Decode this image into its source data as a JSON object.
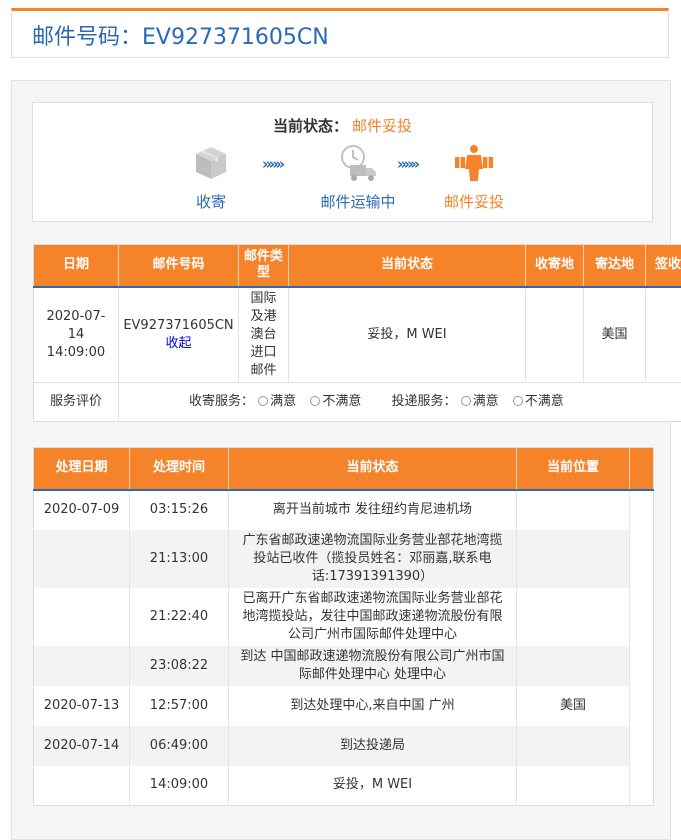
{
  "header": {
    "title": "邮件号码：EV927371605CN"
  },
  "status": {
    "label": "当前状态：",
    "value": "邮件妥投",
    "steps": [
      {
        "label": "收寄",
        "icon": "package-icon"
      },
      {
        "label": "邮件运输中",
        "icon": "truck-icon"
      },
      {
        "label": "邮件妥投",
        "icon": "delivery-person-icon"
      }
    ],
    "arrow": "»»»"
  },
  "summary_table": {
    "headers": [
      "日期",
      "邮件号码",
      "邮件类型",
      "当前状态",
      "收寄地",
      "寄达地",
      "签收人"
    ],
    "row": {
      "date": "2020-07-14 14:09:00",
      "number": "EV927371605CN",
      "collapse": "收起",
      "type": "国际及港澳台进口邮件",
      "status": "妥投，M WEI",
      "origin": "",
      "destination": "美国",
      "signer": ""
    },
    "rating": {
      "label": "服务评价",
      "pickup_label": "收寄服务：",
      "delivery_label": "投递服务：",
      "satisfied": "满意",
      "unsatisfied": "不满意"
    }
  },
  "tracking_table": {
    "headers": [
      "处理日期",
      "处理时间",
      "当前状态",
      "当前位置"
    ],
    "rows": [
      {
        "date": "2020-07-09",
        "time": "03:15:26",
        "status": "离开当前城市 发往纽约肯尼迪机场",
        "location": ""
      },
      {
        "date": "",
        "time": "21:13:00",
        "status": "广东省邮政速递物流国际业务营业部花地湾揽投站已收件（揽投员姓名：邓丽嘉,联系电话:17391391390）",
        "location": ""
      },
      {
        "date": "",
        "time": "21:22:40",
        "status": "已离开广东省邮政速递物流国际业务营业部花地湾揽投站，发往中国邮政速递物流股份有限公司广州市国际邮件处理中心",
        "location": ""
      },
      {
        "date": "",
        "time": "23:08:22",
        "status": "到达 中国邮政速递物流股份有限公司广州市国际邮件处理中心 处理中心",
        "location": ""
      },
      {
        "date": "2020-07-13",
        "time": "12:57:00",
        "status": "到达处理中心,来自中国 广州",
        "location": "美国"
      },
      {
        "date": "2020-07-14",
        "time": "06:49:00",
        "status": "到达投递局",
        "location": ""
      },
      {
        "date": "",
        "time": "14:09:00",
        "status": "妥投，M WEI",
        "location": ""
      }
    ]
  },
  "colors": {
    "accent": "#f5832a",
    "primary": "#2a6ab5"
  }
}
